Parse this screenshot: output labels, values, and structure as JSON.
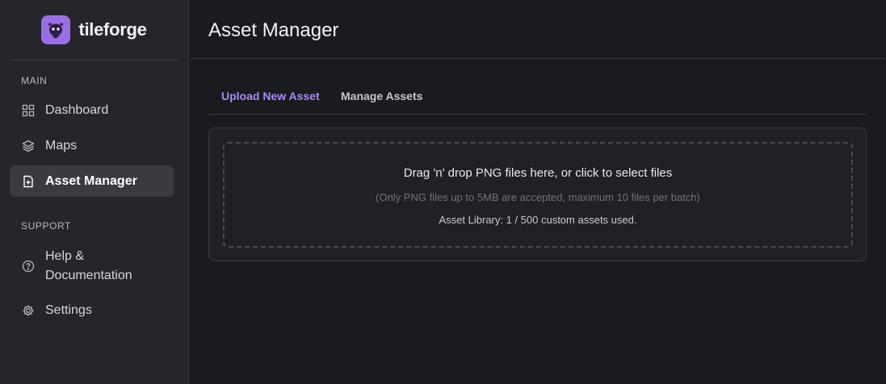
{
  "app": {
    "name": "tileforge",
    "logo_icon": "gargoyle-icon",
    "accent": "#9a6ee6"
  },
  "sidebar": {
    "main_label": "MAIN",
    "support_label": "SUPPORT",
    "main_items": [
      {
        "label": "Dashboard",
        "icon": "grid-icon"
      },
      {
        "label": "Maps",
        "icon": "layers-icon"
      },
      {
        "label": "Asset Manager",
        "icon": "file-plus-icon",
        "active": true
      }
    ],
    "support_items": [
      {
        "label": "Help &",
        "label2": "Documentation",
        "icon": "help-circle-icon"
      },
      {
        "label": "Settings",
        "icon": "gear-icon"
      }
    ]
  },
  "header": {
    "title": "Asset Manager"
  },
  "tabs": [
    {
      "label": "Upload New Asset",
      "active": true
    },
    {
      "label": "Manage Assets",
      "active": false
    }
  ],
  "dropzone": {
    "title": "Drag 'n' drop PNG files here, or click to select files",
    "hint": "(Only PNG files up to 5MB are accepted, maximum 10 files per batch)",
    "library_status": "Asset Library: 1 / 500 custom assets used."
  }
}
